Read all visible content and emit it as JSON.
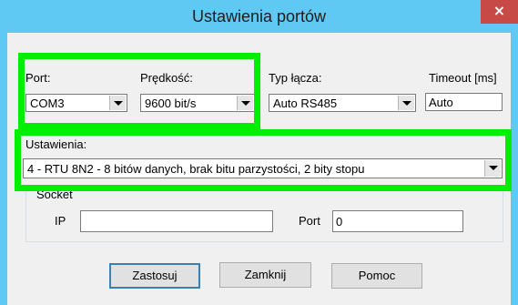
{
  "window": {
    "title": "Ustawienia portów",
    "close_glyph": "×"
  },
  "port": {
    "label": "Port:",
    "value": "COM3"
  },
  "speed": {
    "label": "Prędkość:",
    "value": "9600 bit/s"
  },
  "link_type": {
    "label": "Typ łącza:",
    "value": "Auto RS485"
  },
  "timeout": {
    "label": "Timeout [ms]",
    "value": "Auto"
  },
  "settings": {
    "label": "Ustawienia:",
    "value": "4 - RTU 8N2 - 8 bitów danych, brak bitu parzystości, 2 bity stopu"
  },
  "socket": {
    "group_label": "Socket",
    "ip_label": "IP",
    "ip_value": "",
    "port_label": "Port",
    "port_value": "0"
  },
  "buttons": {
    "apply": "Zastosuj",
    "close": "Zamknij",
    "help": "Pomoc"
  },
  "colors": {
    "titlebar": "#5fc9f3",
    "highlight": "#00ee00",
    "close_button": "#c74a47"
  }
}
